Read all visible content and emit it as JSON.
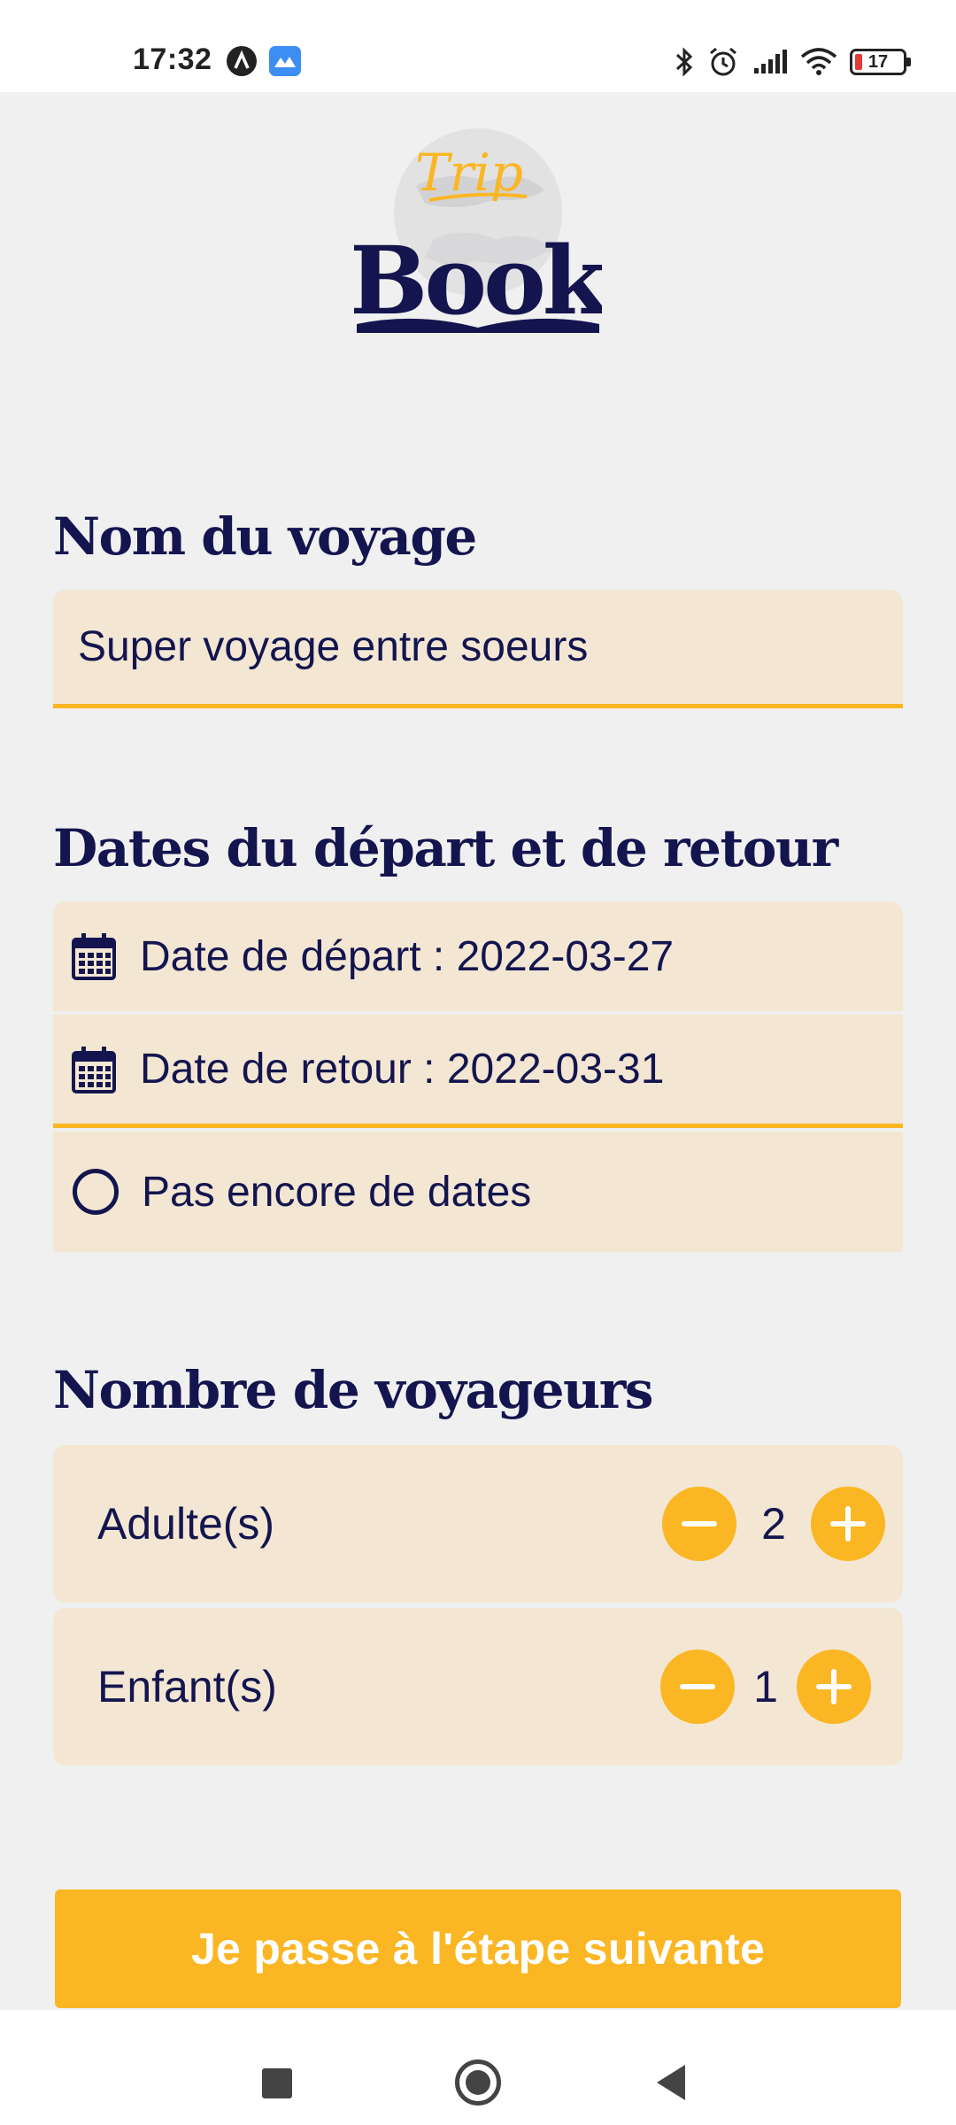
{
  "status_bar": {
    "time": "17:32",
    "battery": "17",
    "icons": [
      "app-a-icon",
      "app-photos-icon",
      "bluetooth-icon",
      "alarm-icon",
      "signal-icon",
      "wifi-icon",
      "battery-icon"
    ]
  },
  "logo": {
    "top_word": "Trip",
    "main_word": "Book"
  },
  "trip_name": {
    "title": "Nom du voyage",
    "value": "Super voyage entre soeurs"
  },
  "dates": {
    "title": "Dates du départ et de retour",
    "departure_label": "Date de départ : 2022-03-27",
    "return_label": "Date de retour : 2022-03-31",
    "no_dates_label": "Pas encore de dates"
  },
  "travelers": {
    "title": "Nombre de voyageurs",
    "adults_label": "Adulte(s)",
    "adults_count": "2",
    "children_label": "Enfant(s)",
    "children_count": "1"
  },
  "next_button": "Je passe à l'étape suivante",
  "colors": {
    "accent": "#fbb623",
    "navy": "#14154f",
    "field_bg": "#f3e7d3",
    "page_bg": "#f0f0f0"
  }
}
